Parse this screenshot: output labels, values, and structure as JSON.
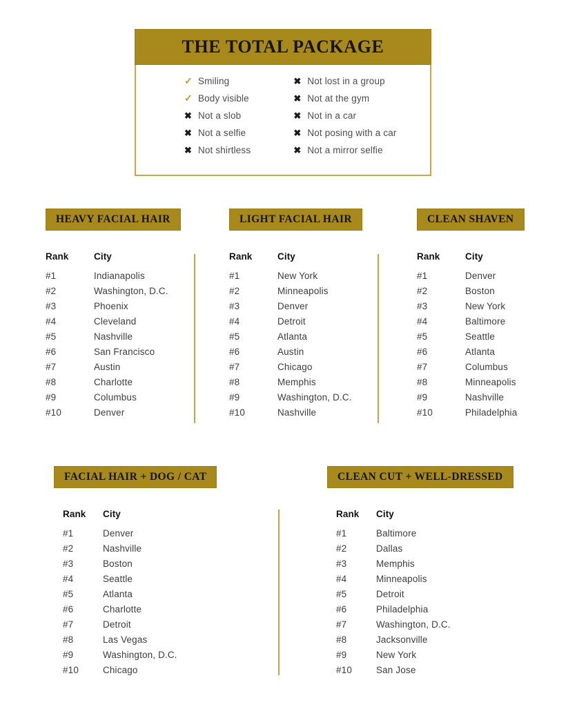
{
  "total_package": {
    "title": "THE TOTAL PACKAGE",
    "left_items": [
      {
        "mark": "check",
        "glyph": "✓",
        "label": "Smiling"
      },
      {
        "mark": "check",
        "glyph": "✓",
        "label": "Body visible"
      },
      {
        "mark": "cross",
        "glyph": "✖",
        "label": "Not a slob"
      },
      {
        "mark": "cross",
        "glyph": "✖",
        "label": "Not a selfie"
      },
      {
        "mark": "cross",
        "glyph": "✖",
        "label": "Not shirtless"
      }
    ],
    "right_items": [
      {
        "mark": "cross",
        "glyph": "✖",
        "label": "Not lost in a group"
      },
      {
        "mark": "cross",
        "glyph": "✖",
        "label": "Not at the gym"
      },
      {
        "mark": "cross",
        "glyph": "✖",
        "label": "Not in a car"
      },
      {
        "mark": "cross",
        "glyph": "✖",
        "label": "Not posing with a car"
      },
      {
        "mark": "cross",
        "glyph": "✖",
        "label": "Not a mirror selfie"
      }
    ]
  },
  "columns": {
    "rank_header": "Rank",
    "city_header": "City"
  },
  "sections": [
    {
      "id": "heavy",
      "title": "HEAVY FACIAL HAIR",
      "rows": [
        {
          "rank": "#1",
          "city": "Indianapolis"
        },
        {
          "rank": "#2",
          "city": "Washington, D.C."
        },
        {
          "rank": "#3",
          "city": "Phoenix"
        },
        {
          "rank": "#4",
          "city": "Cleveland"
        },
        {
          "rank": "#5",
          "city": "Nashville"
        },
        {
          "rank": "#6",
          "city": "San Francisco"
        },
        {
          "rank": "#7",
          "city": "Austin"
        },
        {
          "rank": "#8",
          "city": "Charlotte"
        },
        {
          "rank": "#9",
          "city": "Columbus"
        },
        {
          "rank": "#10",
          "city": "Denver"
        }
      ]
    },
    {
      "id": "light",
      "title": "LIGHT FACIAL HAIR",
      "rows": [
        {
          "rank": "#1",
          "city": "New York"
        },
        {
          "rank": "#2",
          "city": "Minneapolis"
        },
        {
          "rank": "#3",
          "city": "Denver"
        },
        {
          "rank": "#4",
          "city": "Detroit"
        },
        {
          "rank": "#5",
          "city": "Atlanta"
        },
        {
          "rank": "#6",
          "city": "Austin"
        },
        {
          "rank": "#7",
          "city": "Chicago"
        },
        {
          "rank": "#8",
          "city": "Memphis"
        },
        {
          "rank": "#9",
          "city": "Washington, D.C."
        },
        {
          "rank": "#10",
          "city": "Nashville"
        }
      ]
    },
    {
      "id": "clean",
      "title": "CLEAN SHAVEN",
      "rows": [
        {
          "rank": "#1",
          "city": "Denver"
        },
        {
          "rank": "#2",
          "city": "Boston"
        },
        {
          "rank": "#3",
          "city": "New York"
        },
        {
          "rank": "#4",
          "city": "Baltimore"
        },
        {
          "rank": "#5",
          "city": "Seattle"
        },
        {
          "rank": "#6",
          "city": "Atlanta"
        },
        {
          "rank": "#7",
          "city": "Columbus"
        },
        {
          "rank": "#8",
          "city": "Minneapolis"
        },
        {
          "rank": "#9",
          "city": "Nashville"
        },
        {
          "rank": "#10",
          "city": "Philadelphia"
        }
      ]
    },
    {
      "id": "dogcat",
      "title": "FACIAL HAIR + DOG / CAT",
      "rows": [
        {
          "rank": "#1",
          "city": "Denver"
        },
        {
          "rank": "#2",
          "city": "Nashville"
        },
        {
          "rank": "#3",
          "city": "Boston"
        },
        {
          "rank": "#4",
          "city": "Seattle"
        },
        {
          "rank": "#5",
          "city": "Atlanta"
        },
        {
          "rank": "#6",
          "city": "Charlotte"
        },
        {
          "rank": "#7",
          "city": "Detroit"
        },
        {
          "rank": "#8",
          "city": "Las Vegas"
        },
        {
          "rank": "#9",
          "city": "Washington, D.C."
        },
        {
          "rank": "#10",
          "city": "Chicago"
        }
      ]
    },
    {
      "id": "cleancut",
      "title": "CLEAN CUT + WELL-DRESSED",
      "rows": [
        {
          "rank": "#1",
          "city": "Baltimore"
        },
        {
          "rank": "#2",
          "city": "Dallas"
        },
        {
          "rank": "#3",
          "city": "Memphis"
        },
        {
          "rank": "#4",
          "city": "Minneapolis"
        },
        {
          "rank": "#5",
          "city": "Detroit"
        },
        {
          "rank": "#6",
          "city": "Philadelphia"
        },
        {
          "rank": "#7",
          "city": "Washington, D.C."
        },
        {
          "rank": "#8",
          "city": "Jacksonville"
        },
        {
          "rank": "#9",
          "city": "New York"
        },
        {
          "rank": "#10",
          "city": "San Jose"
        }
      ]
    }
  ],
  "colors": {
    "gold_fill": "#A8891C",
    "gold_border": "#C5A847",
    "divider": "#C3A64A",
    "text_dark": "#3d3d3d",
    "check_gold": "#B99A2E"
  }
}
